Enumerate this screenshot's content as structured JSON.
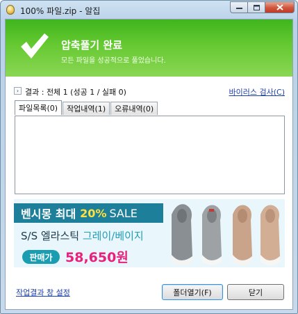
{
  "window": {
    "title": "100% 파일.zip - 알집"
  },
  "banner": {
    "title": "압축풀기 완료",
    "subtitle": "모든 파일을 성공적으로 풀었습니다.",
    "colors": {
      "accent": "#5cc22a",
      "text": "#ffffff"
    }
  },
  "result": {
    "text": "결과 : 전체 1 (성공 1 / 실패 0)",
    "virus_scan_link": "바이러스 검사(C)"
  },
  "tabs": [
    {
      "label": "파일목록(0)",
      "active": true
    },
    {
      "label": "작업내역(1)",
      "active": false
    },
    {
      "label": "오류내역(0)",
      "active": false
    }
  ],
  "ad": {
    "brand_line": "벤시몽 최대",
    "discount": "20%",
    "sale": "SALE",
    "line2_prefix": "S/S 엘라스틱",
    "line2_highlight": "그레이/베이지",
    "price_label": "판매가",
    "price": "58,650원"
  },
  "footer": {
    "settings_link": "작업결과 창 설정",
    "open_folder_button": "폴더열기(F)",
    "close_button": "닫기"
  }
}
